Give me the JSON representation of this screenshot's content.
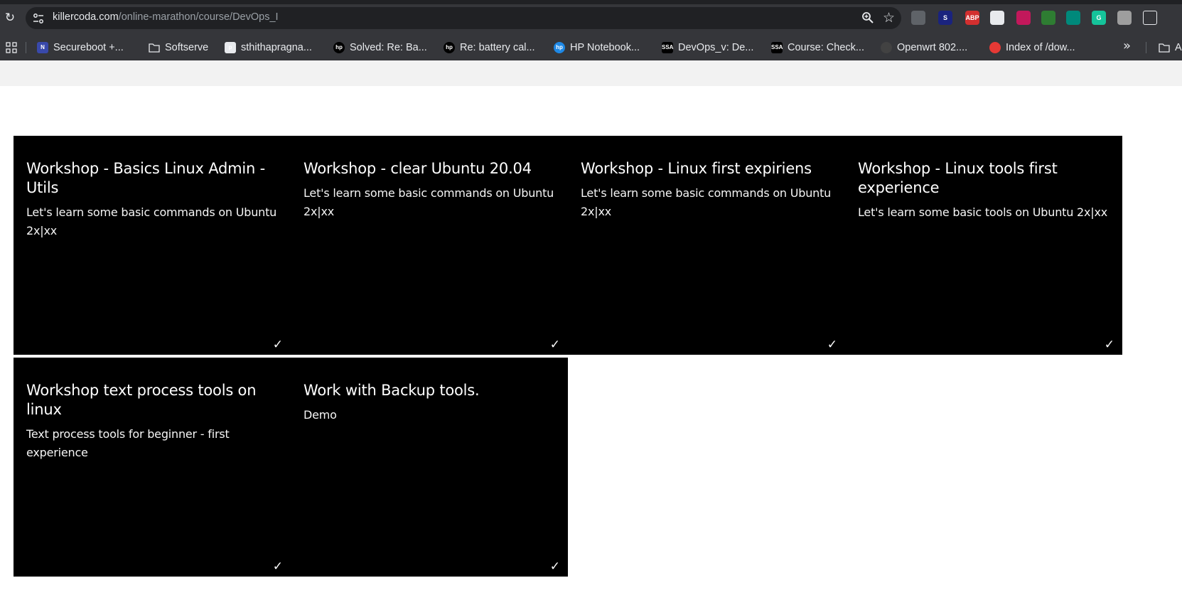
{
  "browser": {
    "url_host": "killercoda.com",
    "url_path": "/online-marathon/course/DevOps_I",
    "extensions": [
      {
        "name": "shield-extension-icon",
        "text": "",
        "color": "#5f6368"
      },
      {
        "name": "s-extension-icon",
        "text": "S",
        "color": "#1a237e"
      },
      {
        "name": "adblock-plus-icon",
        "text": "ABP",
        "color": "#d32f2f"
      },
      {
        "name": "cube-extension-icon",
        "text": "",
        "color": "#e8eaed"
      },
      {
        "name": "crown-extension-icon",
        "text": "",
        "color": "#c2185b"
      },
      {
        "name": "leaf-extension-icon",
        "text": "",
        "color": "#2e7d32"
      },
      {
        "name": "image-extension-icon",
        "text": "",
        "color": "#00897b"
      },
      {
        "name": "grammarly-icon",
        "text": "G",
        "color": "#15c39a"
      },
      {
        "name": "printer-extension-icon",
        "text": "",
        "color": "#9e9e9e"
      },
      {
        "name": "puzzle-extensions-icon",
        "text": "",
        "color": "#35363a"
      }
    ]
  },
  "bookmarks": [
    {
      "label": "Secureboot +...",
      "icon": "N",
      "icon_color": "#3949ab"
    },
    {
      "label": "Softserve",
      "icon": "folder",
      "icon_color": "#e8eaed"
    },
    {
      "label": "sthithapragna...",
      "icon": "p",
      "icon_color": "#e8eaed"
    },
    {
      "label": "Solved: Re: Ba...",
      "icon": "hp",
      "icon_color": "#000000"
    },
    {
      "label": "Re: battery cal...",
      "icon": "hp",
      "icon_color": "#000000"
    },
    {
      "label": "HP Notebook...",
      "icon": "hp",
      "icon_color": "#1e88e5"
    },
    {
      "label": "DevOps_v: De...",
      "icon": "SSA",
      "icon_color": "#000000"
    },
    {
      "label": "Course: Check...",
      "icon": "SSA",
      "icon_color": "#000000"
    },
    {
      "label": "Openwrt 802....",
      "icon": "gh",
      "icon_color": "#424242"
    },
    {
      "label": "Index of /dow...",
      "icon": "rh",
      "icon_color": "#e53935"
    }
  ],
  "bookmarks_overflow_label": "A",
  "courses": [
    {
      "title": "Workshop - Basics Linux Admin - Utils",
      "description": "Let's learn some basic commands on Ubuntu 2x|xx",
      "check": "✓"
    },
    {
      "title": "Workshop - clear Ubuntu 20.04",
      "description": "Let's learn some basic commands on Ubuntu 2x|xx",
      "check": "✓"
    },
    {
      "title": "Workshop - Linux first expiriens",
      "description": "Let's learn some basic commands on Ubuntu 2x|xx",
      "check": "✓"
    },
    {
      "title": "Workshop - Linux tools first experience",
      "description": "Let's learn some basic tools on Ubuntu 2x|xx",
      "check": "✓"
    },
    {
      "title": "Workshop text process tools on linux",
      "description": "Text process tools for beginner - first experience",
      "check": "✓"
    },
    {
      "title": "Work with Backup tools.",
      "description": "Demo",
      "check": "✓"
    }
  ]
}
